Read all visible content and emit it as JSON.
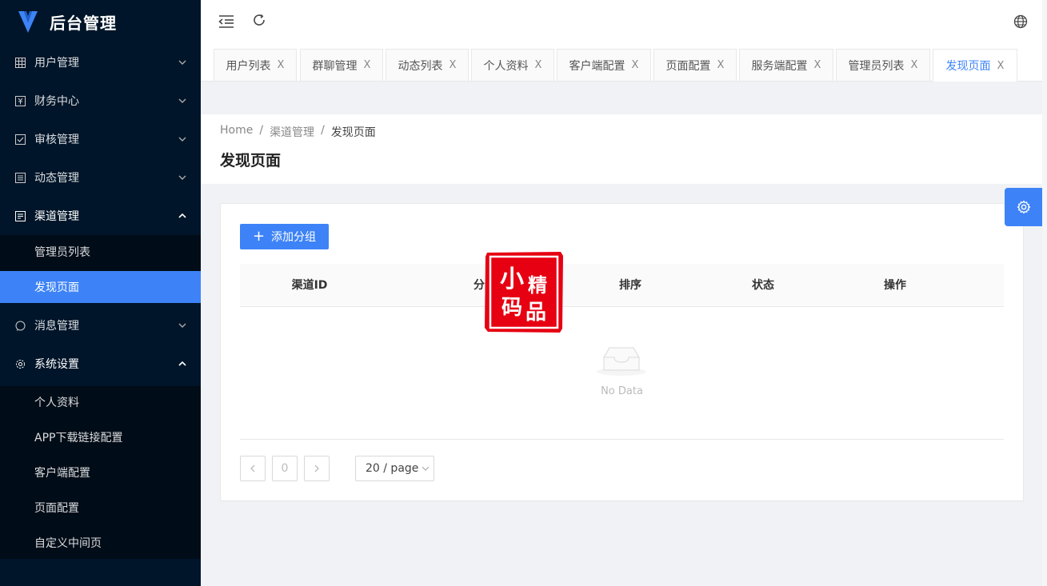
{
  "app": {
    "title": "后台管理"
  },
  "sidebar": {
    "items": [
      {
        "label": "用户管理",
        "icon": "table-icon",
        "expanded": false
      },
      {
        "label": "财务中心",
        "icon": "finance-icon",
        "expanded": false
      },
      {
        "label": "审核管理",
        "icon": "checkbox-icon",
        "expanded": false
      },
      {
        "label": "动态管理",
        "icon": "list-icon",
        "expanded": false
      },
      {
        "label": "渠道管理",
        "icon": "channel-icon",
        "expanded": true,
        "children": [
          {
            "label": "管理员列表"
          },
          {
            "label": "发现页面",
            "active": true
          }
        ]
      },
      {
        "label": "消息管理",
        "icon": "message-icon",
        "expanded": false
      },
      {
        "label": "系统设置",
        "icon": "gear-icon",
        "expanded": true,
        "children": [
          {
            "label": "个人资料"
          },
          {
            "label": "APP下载链接配置"
          },
          {
            "label": "客户端配置"
          },
          {
            "label": "页面配置"
          },
          {
            "label": "自定义中间页"
          }
        ]
      }
    ]
  },
  "tabs": [
    {
      "label": "用户列表"
    },
    {
      "label": "群聊管理"
    },
    {
      "label": "动态列表"
    },
    {
      "label": "个人资料"
    },
    {
      "label": "客户端配置"
    },
    {
      "label": "页面配置"
    },
    {
      "label": "服务端配置"
    },
    {
      "label": "管理员列表"
    },
    {
      "label": "发现页面",
      "active": true
    }
  ],
  "tab_close_glyph": "X",
  "breadcrumb": {
    "home": "Home",
    "sep": "/",
    "level1": "渠道管理",
    "level2": "发现页面"
  },
  "page": {
    "title": "发现页面"
  },
  "toolbar": {
    "add_label": "添加分组"
  },
  "table": {
    "columns": [
      "渠道ID",
      "分组名称",
      "排序",
      "状态",
      "操作"
    ],
    "empty_text": "No Data"
  },
  "pagination": {
    "current": "0",
    "page_size": "20 / page"
  },
  "watermark": {
    "text": "小精码品"
  },
  "colors": {
    "accent": "#3d83f7",
    "sidebar_bg": "#001529",
    "seal": "#e60012"
  }
}
